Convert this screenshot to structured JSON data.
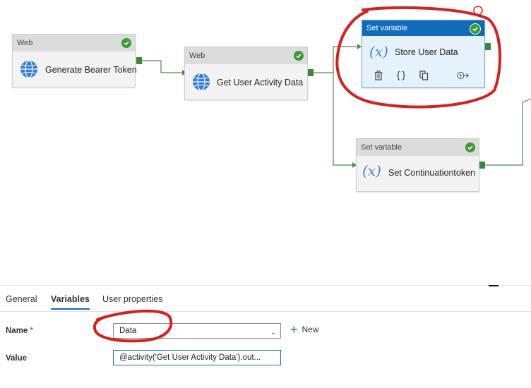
{
  "canvas": {
    "nodes": {
      "bearer": {
        "type_label": "Web",
        "title": "Generate Bearer Token",
        "icon": "globe-icon",
        "status": "succeeded"
      },
      "activity": {
        "type_label": "Web",
        "title": "Get User Activity Data",
        "icon": "globe-icon",
        "status": "succeeded"
      },
      "store": {
        "type_label": "Set variable",
        "title": "Store User Data",
        "icon": "variable-icon",
        "status": "succeeded",
        "selected": true,
        "toolbar": [
          "delete-icon",
          "code-icon",
          "copy-icon",
          "add-output-icon"
        ]
      },
      "continuation": {
        "type_label": "Set variable",
        "title": "Set Continuationtoken",
        "icon": "variable-icon",
        "status": "succeeded"
      }
    },
    "colors": {
      "accent": "#0f6cbd",
      "success": "#3a9b35",
      "port": "#3a8a3a",
      "annotation": "#d62020"
    }
  },
  "panel": {
    "tabs": [
      "General",
      "Variables",
      "User properties"
    ],
    "active_tab": "Variables",
    "name_label": "Name",
    "required_marker": "*",
    "name_value": "Data",
    "new_label": "New",
    "value_label": "Value",
    "value_text": "@activity('Get User Activity Data').out..."
  }
}
